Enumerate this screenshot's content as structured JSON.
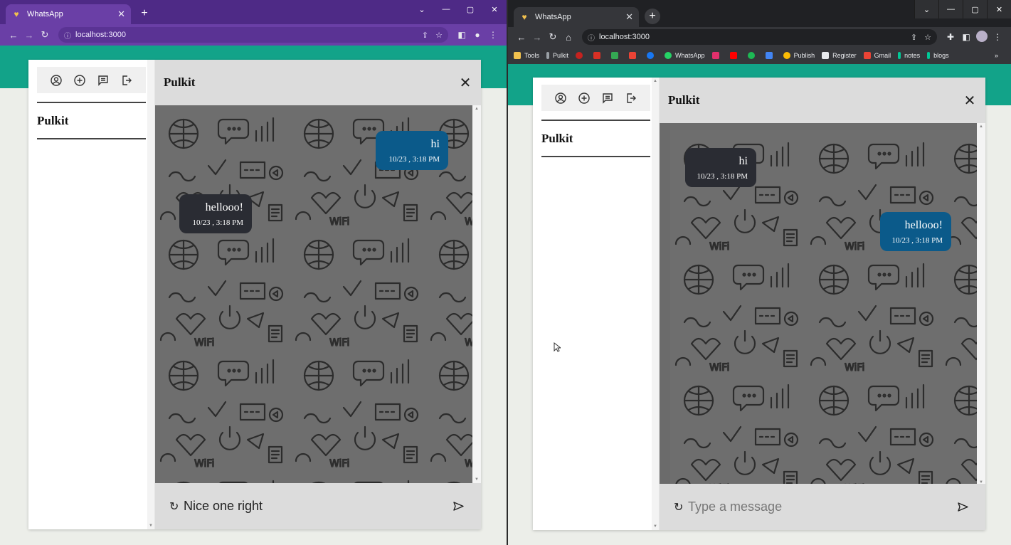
{
  "left_window": {
    "tab_title": "WhatsApp",
    "url": "localhost:3000",
    "sidebar": {
      "contact": "Pulkit"
    },
    "chat": {
      "contact_name": "Pulkit",
      "messages": [
        {
          "text": "hi",
          "time": "10/23 , 3:18 PM",
          "direction": "out"
        },
        {
          "text": "hellooo!",
          "time": "10/23 , 3:18 PM",
          "direction": "in"
        }
      ],
      "composer": {
        "value": "Nice one right",
        "placeholder": "Type a message"
      }
    },
    "colors": {
      "titlebar": "#4e2a86",
      "accent": "#12a389"
    }
  },
  "right_window": {
    "tab_title": "WhatsApp",
    "url": "localhost:3000",
    "bookmarks": [
      "Tools",
      "Pulkit",
      "WhatsApp",
      "Publish",
      "Register",
      "Gmail",
      "notes",
      "blogs"
    ],
    "sidebar": {
      "contact": "Pulkit"
    },
    "chat": {
      "contact_name": "Pulkit",
      "messages": [
        {
          "text": "hi",
          "time": "10/23 , 3:18 PM",
          "direction": "in"
        },
        {
          "text": "hellooo!",
          "time": "10/23 , 3:18 PM",
          "direction": "out"
        }
      ],
      "composer": {
        "value": "",
        "placeholder": "Type a message"
      }
    },
    "colors": {
      "titlebar": "#202124",
      "accent": "#12a389"
    }
  },
  "icons": [
    "profile-icon",
    "add-icon",
    "chat-icon",
    "logout-icon",
    "close-icon",
    "refresh-icon",
    "send-icon"
  ]
}
